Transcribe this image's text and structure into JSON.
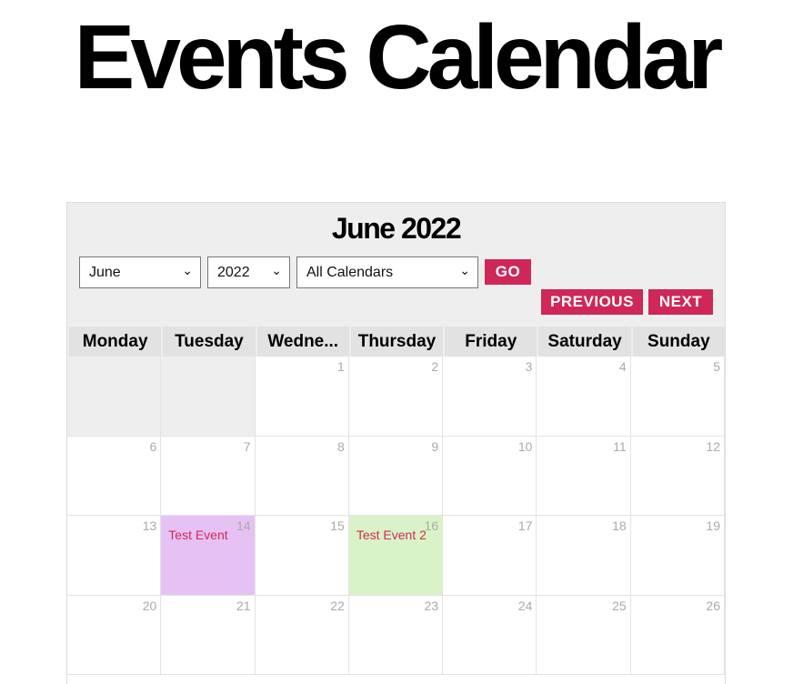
{
  "page_title": "Events Calendar",
  "calendar": {
    "month_title": "June 2022",
    "month_select": "June",
    "year_select": "2022",
    "calendar_select": "All Calendars",
    "go_label": "GO",
    "previous_label": "PREVIOUS",
    "next_label": "NEXT",
    "weekdays": [
      "Monday",
      "Tuesday",
      "Wedne...",
      "Thursday",
      "Friday",
      "Saturday",
      "Sunday"
    ],
    "weeks": [
      [
        "",
        "",
        "1",
        "2",
        "3",
        "4",
        "5"
      ],
      [
        "6",
        "7",
        "8",
        "9",
        "10",
        "11",
        "12"
      ],
      [
        "13",
        "14",
        "15",
        "16",
        "17",
        "18",
        "19"
      ],
      [
        "20",
        "21",
        "22",
        "23",
        "24",
        "25",
        "26"
      ]
    ],
    "events": [
      {
        "day": "14",
        "title": "Test Event",
        "color": "#e6c1f4"
      },
      {
        "day": "16",
        "title": "Test Event 2",
        "color": "#d9f3c8"
      }
    ],
    "accent": "#cf2757"
  }
}
